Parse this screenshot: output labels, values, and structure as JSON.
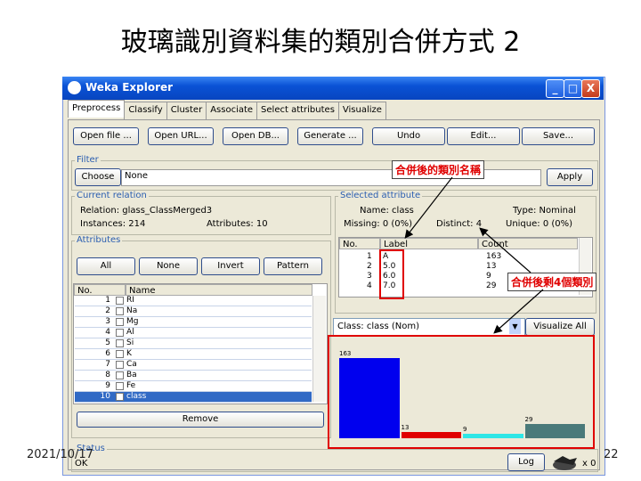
{
  "slide": {
    "title": "玻璃識別資料集的類別合併方式 2",
    "date": "2021/10/17",
    "page": "22"
  },
  "window": {
    "title": "Weka Explorer",
    "btn_min": "_",
    "btn_max": "□",
    "btn_close": "X"
  },
  "tabs": [
    "Preprocess",
    "Classify",
    "Cluster",
    "Associate",
    "Select attributes",
    "Visualize"
  ],
  "toolbar": [
    "Open file ...",
    "Open URL...",
    "Open DB...",
    "Generate ...",
    "Undo",
    "Edit...",
    "Save..."
  ],
  "filter": {
    "label": "Filter",
    "choose": "Choose",
    "value": "None",
    "apply": "Apply"
  },
  "current_relation": {
    "label": "Current relation",
    "relation": "Relation: glass_ClassMerged3",
    "instances": "Instances: 214",
    "attributes": "Attributes: 10"
  },
  "attributes_panel": {
    "label": "Attributes",
    "buttons": [
      "All",
      "None",
      "Invert",
      "Pattern"
    ],
    "col_no": "No.",
    "col_name": "Name",
    "rows": [
      {
        "no": "1",
        "name": "RI"
      },
      {
        "no": "2",
        "name": "Na"
      },
      {
        "no": "3",
        "name": "Mg"
      },
      {
        "no": "4",
        "name": "Al"
      },
      {
        "no": "5",
        "name": "Si"
      },
      {
        "no": "6",
        "name": "K"
      },
      {
        "no": "7",
        "name": "Ca"
      },
      {
        "no": "8",
        "name": "Ba"
      },
      {
        "no": "9",
        "name": "Fe"
      },
      {
        "no": "10",
        "name": "class"
      }
    ],
    "remove": "Remove"
  },
  "selected_attribute": {
    "label": "Selected attribute",
    "name": "Name: class",
    "type": "Type: Nominal",
    "missing": "Missing: 0 (0%)",
    "distinct": "Distinct: 4",
    "unique": "Unique: 0 (0%)",
    "col_no": "No.",
    "col_label": "Label",
    "col_count": "Count",
    "rows": [
      {
        "no": "1",
        "label": "A",
        "count": "163"
      },
      {
        "no": "2",
        "label": "5.0",
        "count": "13"
      },
      {
        "no": "3",
        "label": "6.0",
        "count": "9"
      },
      {
        "no": "4",
        "label": "7.0",
        "count": "29"
      }
    ]
  },
  "class_selector": {
    "value": "Class: class (Nom)",
    "visualize_all": "Visualize All"
  },
  "histogram": {
    "bars": [
      {
        "value": 163,
        "label": "163",
        "color": "#0000ee"
      },
      {
        "value": 13,
        "label": "13",
        "color": "#e00000"
      },
      {
        "value": 9,
        "label": "9",
        "color": "#2ee6e6"
      },
      {
        "value": 29,
        "label": "29",
        "color": "#4a7a7a"
      }
    ]
  },
  "status": {
    "label": "Status",
    "value": "OK",
    "log": "Log",
    "x0": "x 0"
  },
  "annotations": {
    "merged_names": "合併後的類別名稱",
    "four_classes": "合併後剩4個類別"
  }
}
